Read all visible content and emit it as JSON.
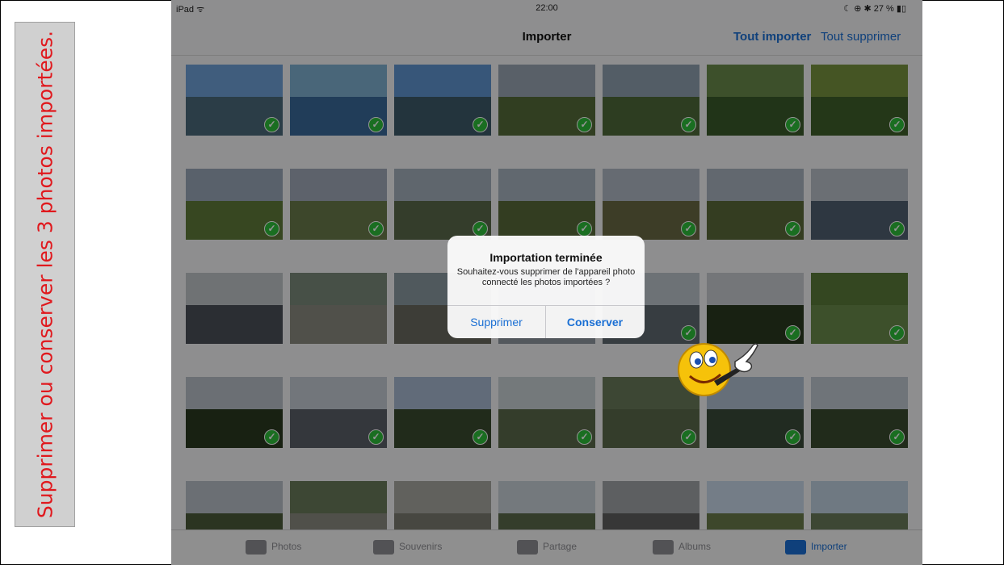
{
  "caption": {
    "text": "Supprimer ou conserver les 3 photos importées."
  },
  "statusbar": {
    "device": "iPad ᯤ",
    "time": "22:00",
    "right": "☾ ⊕ ✱ 27 % ▮▯"
  },
  "navbar": {
    "title": "Importer",
    "import_all": "Tout importer",
    "delete_all": "Tout supprimer"
  },
  "thumbnails": {
    "colors": [
      [
        "#6fa0d8",
        "#4a6a7a"
      ],
      [
        "#7fb0d0",
        "#3a6a9a"
      ],
      [
        "#5f95d0",
        "#3d5a6a"
      ],
      [
        "#9aa6b4",
        "#556b3a"
      ],
      [
        "#8fa0b0",
        "#4f6a3a"
      ],
      [
        "#6a8a4a",
        "#3a5a2a"
      ],
      [
        "#78933e",
        "#3f5f2a"
      ],
      [
        "#9aa8b8",
        "#5f7a3a"
      ],
      [
        "#a0aab8",
        "#6a7a4a"
      ],
      [
        "#a4b0bc",
        "#5a6a4a"
      ],
      [
        "#a8b4c0",
        "#586a3a"
      ],
      [
        "#b0b8c4",
        "#6a6a44"
      ],
      [
        "#aab4c0",
        "#5a6a3a"
      ],
      [
        "#b8c0c8",
        "#506070"
      ],
      [
        "#c0c4c8",
        "#4a5058"
      ],
      [
        "#7a8a7a",
        "#8a8a80"
      ],
      [
        "#8a9aa0",
        "#6a6a60"
      ],
      [
        "#c4c8cc",
        "#9098a0"
      ],
      [
        "#bcc4cc",
        "#606a70"
      ],
      [
        "#c8ccd0",
        "#2a3a20"
      ],
      [
        "#5a7a3a",
        "#6a8a4a"
      ],
      [
        "#b8c0c8",
        "#2a3a20"
      ],
      [
        "#c4ccd4",
        "#5a6068"
      ],
      [
        "#a8b8d0",
        "#3a4a30"
      ],
      [
        "#c8d0d4",
        "#5a6a4a"
      ],
      [
        "#6a7a5a",
        "#5a6a4a"
      ],
      [
        "#b0c0d0",
        "#3a4a3a"
      ],
      [
        "#c0c8d0",
        "#3a4a30"
      ],
      [
        "#b8c0c8",
        "#4a5a3a"
      ],
      [
        "#6a7a5a",
        "#8a8a80"
      ],
      [
        "#a8a8a0",
        "#7a7a70"
      ],
      [
        "#c8d0d8",
        "#5a6a4a"
      ],
      [
        "#a0a4a8",
        "#606060"
      ],
      [
        "#c8d8e8",
        "#6a7a4a"
      ],
      [
        "#c0d0e0",
        "#6a7a5a"
      ]
    ],
    "checked": [
      true,
      true,
      true,
      true,
      true,
      true,
      true,
      true,
      true,
      true,
      true,
      true,
      true,
      true,
      false,
      false,
      false,
      false,
      true,
      true,
      true,
      true,
      true,
      true,
      true,
      true,
      true,
      true,
      false,
      false,
      false,
      false,
      false,
      false,
      false
    ],
    "check_glyph": "✓"
  },
  "alert": {
    "title": "Importation terminée",
    "message": "Souhaitez-vous supprimer de l'appareil photo connecté les photos importées ?",
    "btn_delete": "Supprimer",
    "btn_keep": "Conserver"
  },
  "tabs": [
    {
      "label": "Photos",
      "icon": "photos-icon",
      "active": false
    },
    {
      "label": "Souvenirs",
      "icon": "memories-icon",
      "active": false
    },
    {
      "label": "Partage",
      "icon": "cloud-icon",
      "active": false
    },
    {
      "label": "Albums",
      "icon": "albums-icon",
      "active": false
    },
    {
      "label": "Importer",
      "icon": "import-icon",
      "active": true
    }
  ],
  "accent_color": "#1a6fd4",
  "check_color": "#2ebd3a",
  "caption_color": "#e0191e"
}
